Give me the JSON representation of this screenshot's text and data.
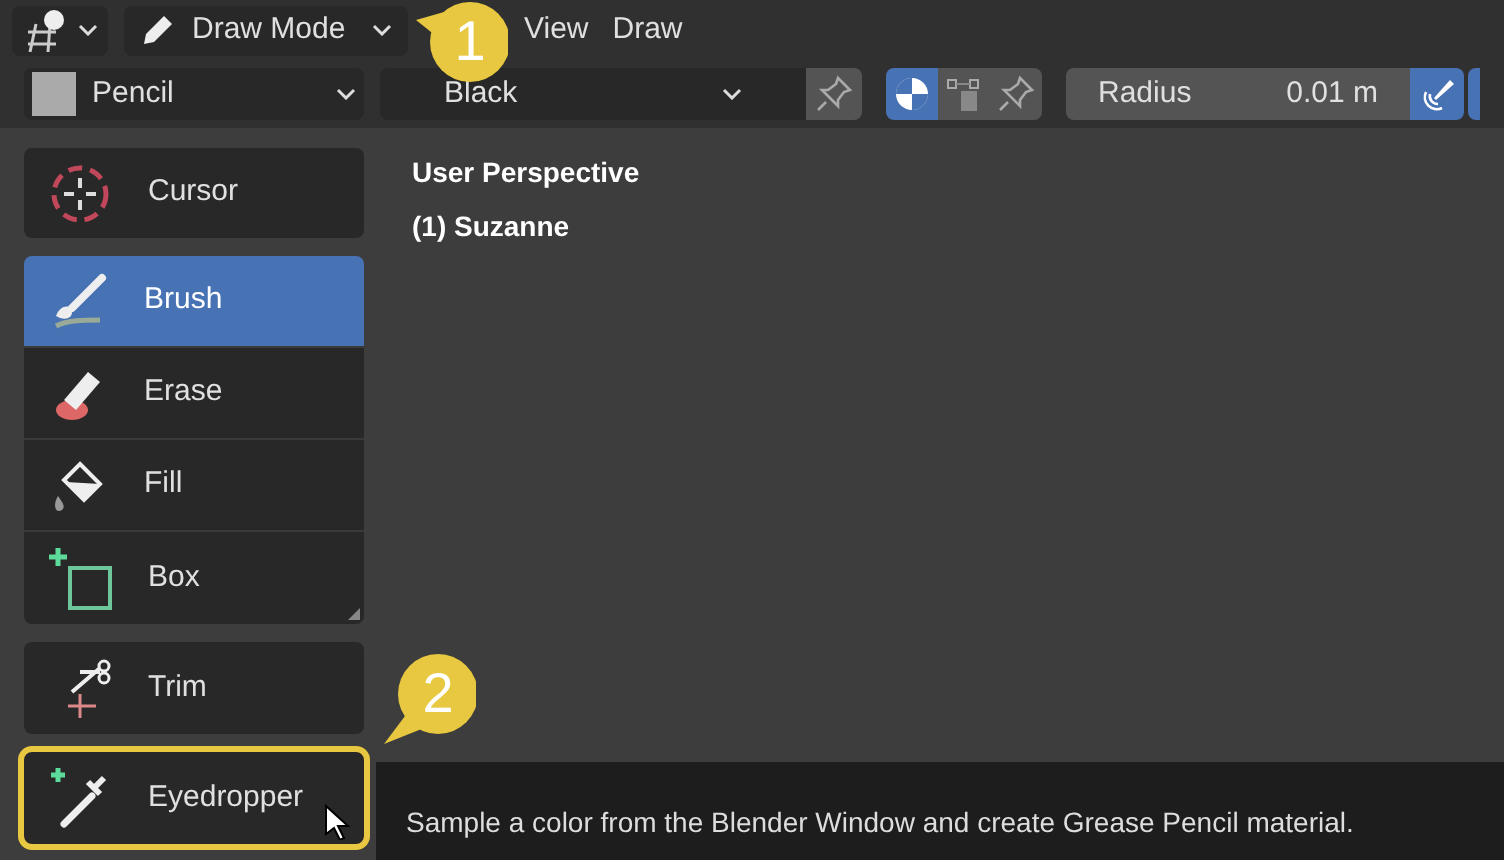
{
  "header": {
    "mode": "Draw Mode",
    "menus": [
      "View",
      "Draw"
    ]
  },
  "tool_settings": {
    "brush": "Pencil",
    "material": "Black",
    "radius_label": "Radius",
    "radius_value": "0.01 m",
    "pin_on": false,
    "mode_toggle_on": true,
    "pressure_on": true
  },
  "viewport": {
    "lines": [
      "User Perspective",
      "(1) Suzanne"
    ]
  },
  "tool_groups": [
    {
      "tools": [
        {
          "kind": "cursor",
          "label": "Cursor",
          "selected": false,
          "highlighted": false
        }
      ]
    },
    {
      "tools": [
        {
          "kind": "brush",
          "label": "Brush",
          "selected": true,
          "highlighted": false
        },
        {
          "kind": "erase",
          "label": "Erase",
          "selected": false,
          "highlighted": false
        },
        {
          "kind": "fill",
          "label": "Fill",
          "selected": false,
          "highlighted": false
        },
        {
          "kind": "box",
          "label": "Box",
          "selected": false,
          "highlighted": false
        }
      ]
    },
    {
      "tools": [
        {
          "kind": "trim",
          "label": "Trim",
          "selected": false,
          "highlighted": false
        }
      ]
    },
    {
      "tools": [
        {
          "kind": "eyedropper",
          "label": "Eyedropper",
          "selected": false,
          "highlighted": true
        }
      ]
    }
  ],
  "tooltip": {
    "text": "Sample a color from the Blender Window and create Grease Pencil material."
  },
  "callouts": [
    "1",
    "2"
  ]
}
